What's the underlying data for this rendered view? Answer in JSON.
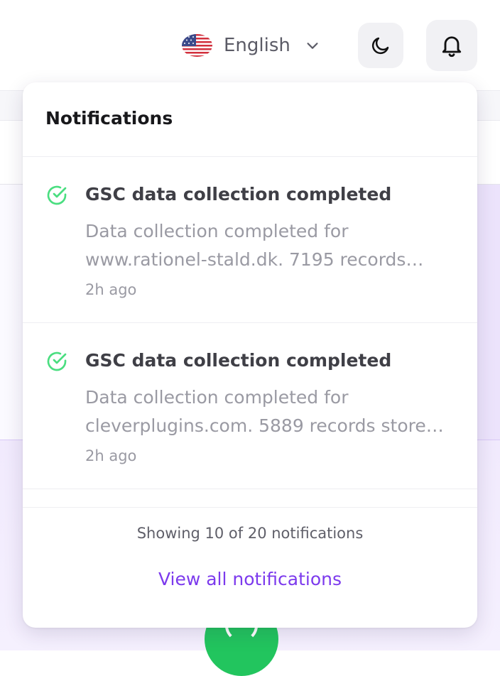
{
  "header": {
    "language_label": "English",
    "language_flag": "us-flag-icon"
  },
  "notifications": {
    "title": "Notifications",
    "items": [
      {
        "title": "GSC data collection completed",
        "body": "Data collection completed for www.rationel-stald.dk. 7195 records…",
        "time": "2h ago",
        "status_icon": "check-circle-icon"
      },
      {
        "title": "GSC data collection completed",
        "body": "Data collection completed for cleverplugins.com. 5889 records store…",
        "time": "2h ago",
        "status_icon": "check-circle-icon"
      }
    ],
    "footer_count": "Showing 10 of 20 notifications",
    "view_all_label": "View all notifications"
  },
  "colors": {
    "accent": "#7c3aed",
    "success": "#22c55e"
  }
}
